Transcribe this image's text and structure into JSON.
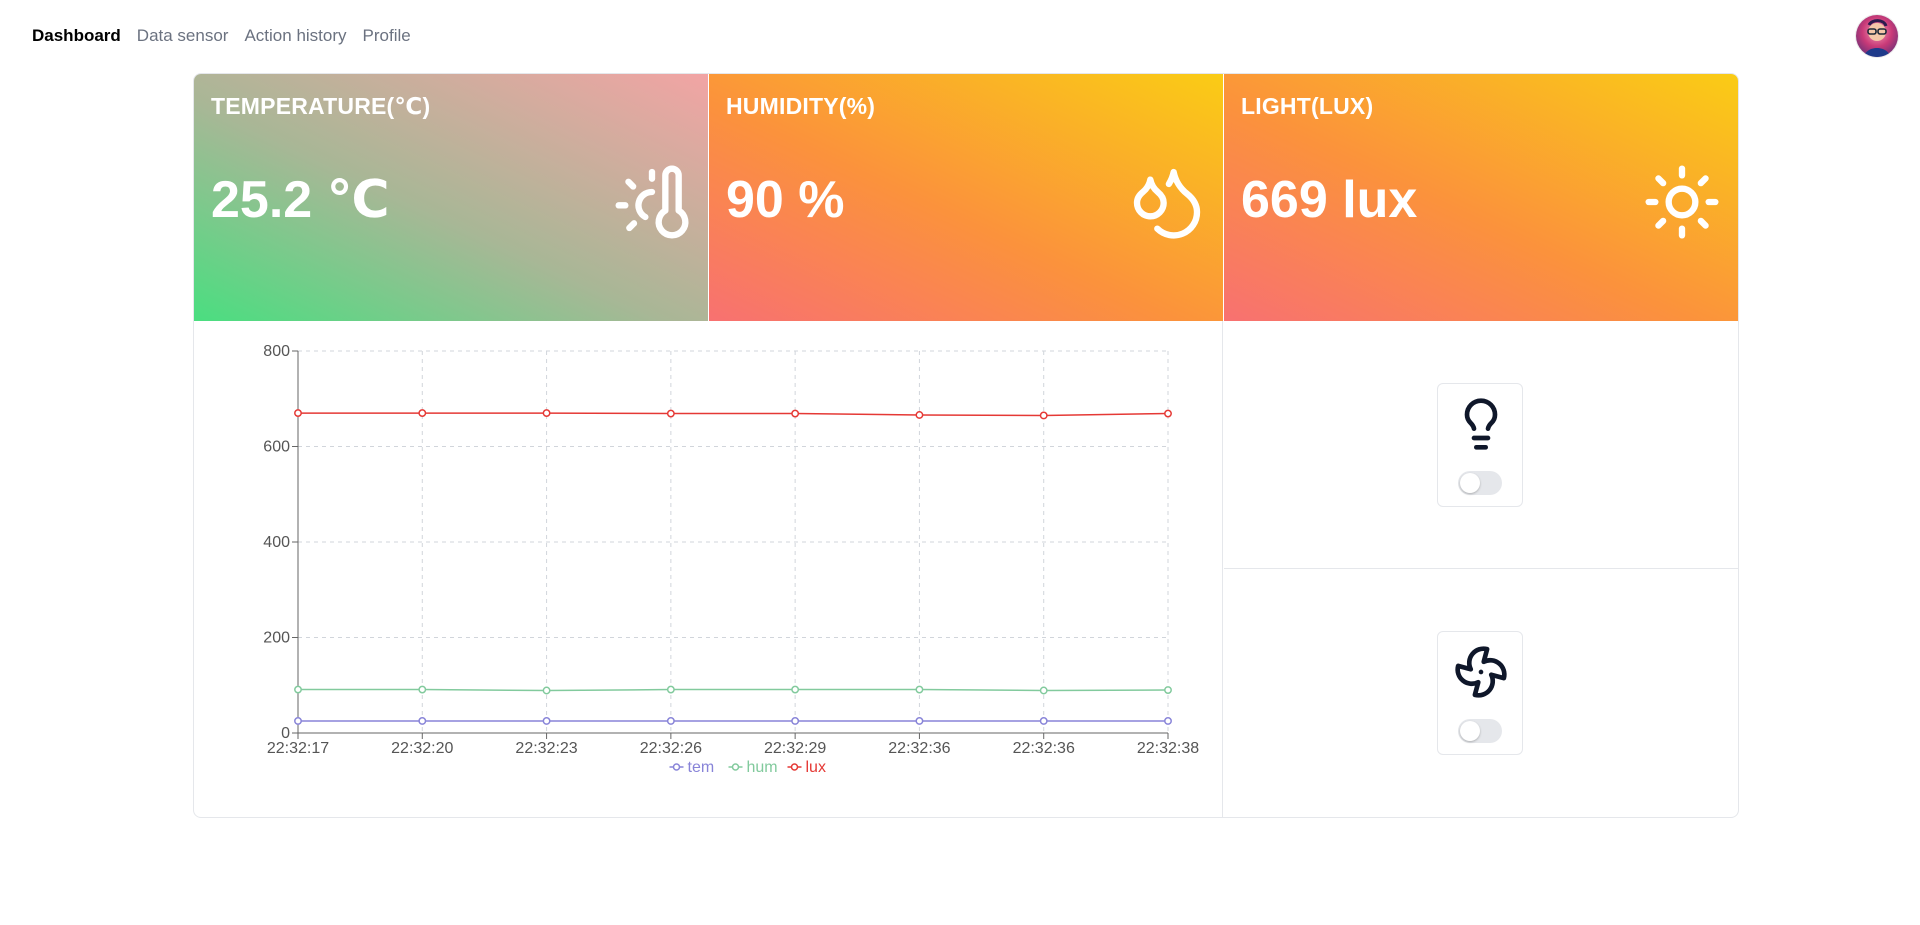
{
  "nav": {
    "items": [
      {
        "label": "Dashboard",
        "active": true
      },
      {
        "label": "Data sensor",
        "active": false
      },
      {
        "label": "Action history",
        "active": false
      },
      {
        "label": "Profile",
        "active": false
      }
    ]
  },
  "cards": {
    "temperature": {
      "title": "TEMPERATURE(℃)",
      "value": "25.2 ℃",
      "icon": "thermometer-sun-icon"
    },
    "humidity": {
      "title": "HUMIDITY(%)",
      "value": "90 %",
      "icon": "droplets-icon"
    },
    "light": {
      "title": "LIGHT(LUX)",
      "value": "669 lux",
      "icon": "sun-icon"
    }
  },
  "devices": {
    "light": {
      "icon": "lightbulb-icon",
      "on": false
    },
    "fan": {
      "icon": "fan-icon",
      "on": false
    }
  },
  "colors": {
    "tem": "#8884d8",
    "hum": "#82ca9d",
    "lux": "#e53935",
    "toggle_off": "#e5e7eb"
  },
  "chart_data": {
    "type": "line",
    "x": [
      "22:32:17",
      "22:32:20",
      "22:32:23",
      "22:32:26",
      "22:32:29",
      "22:32:36",
      "22:32:36",
      "22:32:38"
    ],
    "series": [
      {
        "name": "tem",
        "values": [
          25.2,
          25.2,
          25.2,
          25.2,
          25.2,
          25.2,
          25.2,
          25.2
        ]
      },
      {
        "name": "hum",
        "values": [
          91,
          91,
          89,
          91,
          91,
          91,
          89,
          90
        ]
      },
      {
        "name": "lux",
        "values": [
          670,
          670,
          670,
          669,
          669,
          666,
          665,
          669
        ]
      }
    ],
    "ylim": [
      0,
      800
    ],
    "yticks": [
      0,
      200,
      400,
      600,
      800
    ],
    "grid": true,
    "legend": "bottom-center"
  }
}
